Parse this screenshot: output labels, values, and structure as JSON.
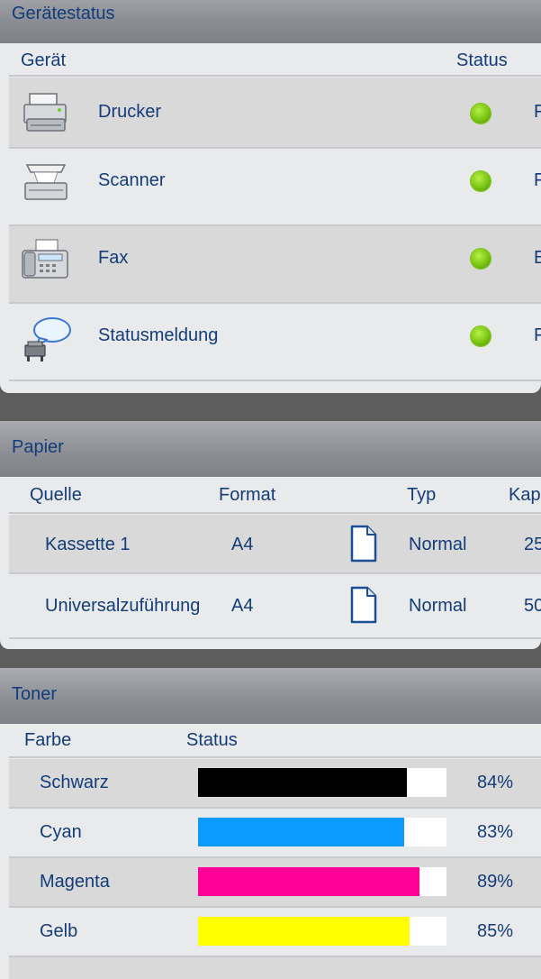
{
  "device_status": {
    "title": "Gerätestatus",
    "col_device": "Gerät",
    "col_status": "Status",
    "status_color": "#79c410",
    "rows": [
      {
        "name": "Drucker",
        "icon": "printer-icon",
        "status_text": "F"
      },
      {
        "name": "Scanner",
        "icon": "scanner-icon",
        "status_text": "F"
      },
      {
        "name": "Fax",
        "icon": "fax-icon",
        "status_text": "E"
      },
      {
        "name": "Statusmeldung",
        "icon": "status-message-icon",
        "status_text": "F"
      }
    ]
  },
  "paper": {
    "title": "Papier",
    "col_source": "Quelle",
    "col_format": "Format",
    "col_type": "Typ",
    "col_capacity": "Kap",
    "rows": [
      {
        "source": "Kassette 1",
        "format": "A4",
        "type": "Normal",
        "capacity": "25"
      },
      {
        "source": "Universalzuführung",
        "format": "A4",
        "type": "Normal",
        "capacity": "50"
      }
    ]
  },
  "toner": {
    "title": "Toner",
    "col_color": "Farbe",
    "col_status": "Status",
    "rows": [
      {
        "name": "Schwarz",
        "percent_label": "84%",
        "level": 0.84,
        "color": "#000000"
      },
      {
        "name": "Cyan",
        "percent_label": "83%",
        "level": 0.83,
        "color": "#0b9bff"
      },
      {
        "name": "Magenta",
        "percent_label": "89%",
        "level": 0.89,
        "color": "#ff0099"
      },
      {
        "name": "Gelb",
        "percent_label": "85%",
        "level": 0.85,
        "color": "#ffff00"
      }
    ]
  }
}
